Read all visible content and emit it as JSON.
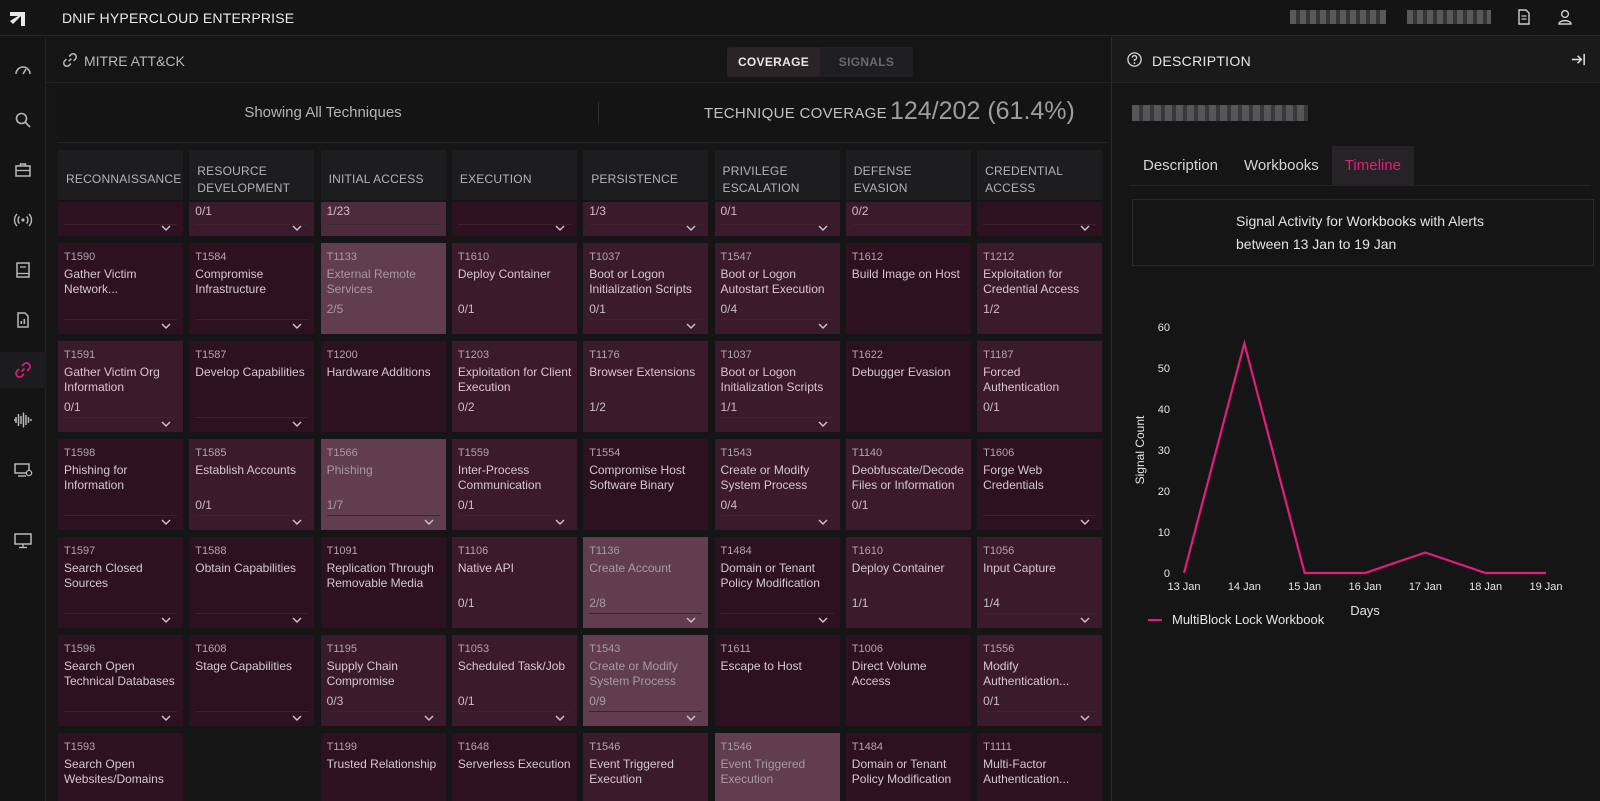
{
  "app": {
    "title": "DNIF HYPERCLOUD ENTERPRISE"
  },
  "topbar": {
    "icons": [
      "document-icon",
      "user-icon"
    ]
  },
  "nav": {
    "icons": [
      "dashboard-icon",
      "search-icon",
      "briefcase-icon",
      "signal-icon",
      "book-icon",
      "report-icon",
      "link-icon",
      "waveform-icon",
      "monitor-settings-icon",
      "desktop-icon"
    ],
    "active": "link-icon"
  },
  "mitre": {
    "title": "MITRE ATT&CK",
    "tabs": [
      {
        "label": "COVERAGE",
        "active": true
      },
      {
        "label": "SIGNALS",
        "active": false
      }
    ],
    "showing": "Showing All Techniques",
    "coverage_label": "TECHNIQUE COVERAGE",
    "coverage_value": "124/202 (61.4%)"
  },
  "matrix": {
    "columns": [
      {
        "header": "RECONNAISSANCE",
        "top_count": "",
        "top_shade": "base",
        "cards": [
          {
            "id": "T1590",
            "name": "Gather Victim Network...",
            "count": "",
            "shade": "base",
            "chevron": true
          },
          {
            "id": "T1591",
            "name": "Gather Victim Org Information",
            "count": "0/1",
            "shade": "light",
            "chevron": true
          },
          {
            "id": "T1598",
            "name": "Phishing for Information",
            "count": "",
            "shade": "base",
            "chevron": true
          },
          {
            "id": "T1597",
            "name": "Search Closed Sources",
            "count": "",
            "shade": "base",
            "chevron": true
          },
          {
            "id": "T1596",
            "name": "Search Open Technical Databases",
            "count": "",
            "shade": "base",
            "chevron": true
          },
          {
            "id": "T1593",
            "name": "Search Open Websites/Domains",
            "count": "",
            "shade": "base",
            "chevron": false
          }
        ]
      },
      {
        "header": "RESOURCE DEVELOPMENT",
        "top_count": "0/1",
        "top_shade": "light",
        "cards": [
          {
            "id": "T1584",
            "name": "Compromise Infrastructure",
            "count": "",
            "shade": "base",
            "chevron": true
          },
          {
            "id": "T1587",
            "name": "Develop Capabilities",
            "count": "",
            "shade": "base",
            "chevron": true
          },
          {
            "id": "T1585",
            "name": "Establish Accounts",
            "count": "0/1",
            "shade": "light",
            "chevron": true
          },
          {
            "id": "T1588",
            "name": "Obtain Capabilities",
            "count": "",
            "shade": "base",
            "chevron": true
          },
          {
            "id": "T1608",
            "name": "Stage Capabilities",
            "count": "",
            "shade": "base",
            "chevron": true
          }
        ]
      },
      {
        "header": "INITIAL ACCESS",
        "top_count": "1/23",
        "top_shade": "lighter",
        "cards": [
          {
            "id": "T1133",
            "name": "External Remote Services",
            "count": "2/5",
            "shade": "lightest",
            "chevron": false
          },
          {
            "id": "T1200",
            "name": "Hardware Additions",
            "count": "",
            "shade": "base",
            "chevron": false
          },
          {
            "id": "T1566",
            "name": "Phishing",
            "count": "1/7",
            "shade": "lightest",
            "chevron": true
          },
          {
            "id": "T1091",
            "name": "Replication Through Removable Media",
            "count": "",
            "shade": "base",
            "chevron": false
          },
          {
            "id": "T1195",
            "name": "Supply Chain Compromise",
            "count": "0/3",
            "shade": "light",
            "chevron": true
          },
          {
            "id": "T1199",
            "name": "Trusted Relationship",
            "count": "",
            "shade": "base",
            "chevron": false
          }
        ]
      },
      {
        "header": "EXECUTION",
        "top_count": "",
        "top_shade": "base",
        "cards": [
          {
            "id": "T1610",
            "name": "Deploy Container",
            "count": "0/1",
            "shade": "light",
            "chevron": false
          },
          {
            "id": "T1203",
            "name": "Exploitation for Client Execution",
            "count": "0/2",
            "shade": "light",
            "chevron": false
          },
          {
            "id": "T1559",
            "name": "Inter-Process Communication",
            "count": "0/1",
            "shade": "light",
            "chevron": true
          },
          {
            "id": "T1106",
            "name": "Native API",
            "count": "0/1",
            "shade": "light",
            "chevron": false
          },
          {
            "id": "T1053",
            "name": "Scheduled Task/Job",
            "count": "0/1",
            "shade": "light",
            "chevron": true
          },
          {
            "id": "T1648",
            "name": "Serverless Execution",
            "count": "",
            "shade": "base",
            "chevron": false
          }
        ]
      },
      {
        "header": "PERSISTENCE",
        "top_count": "1/3",
        "top_shade": "light",
        "cards": [
          {
            "id": "T1037",
            "name": "Boot or Logon Initialization Scripts",
            "count": "0/1",
            "shade": "light",
            "chevron": true
          },
          {
            "id": "T1176",
            "name": "Browser Extensions",
            "count": "1/2",
            "shade": "light",
            "chevron": false
          },
          {
            "id": "T1554",
            "name": "Compromise Host Software Binary",
            "count": "",
            "shade": "base",
            "chevron": false
          },
          {
            "id": "T1136",
            "name": "Create Account",
            "count": "2/8",
            "shade": "lightest",
            "chevron": true
          },
          {
            "id": "T1543",
            "name": "Create or Modify System Process",
            "count": "0/9",
            "shade": "lightest",
            "chevron": true
          },
          {
            "id": "T1546",
            "name": "Event Triggered Execution",
            "count": "",
            "shade": "light",
            "chevron": false
          }
        ]
      },
      {
        "header": "PRIVILEGE ESCALATION",
        "top_count": "0/1",
        "top_shade": "light",
        "cards": [
          {
            "id": "T1547",
            "name": "Boot or Logon Autostart Execution",
            "count": "0/4",
            "shade": "light",
            "chevron": true
          },
          {
            "id": "T1037",
            "name": "Boot or Logon Initialization Scripts",
            "count": "1/1",
            "shade": "light",
            "chevron": true
          },
          {
            "id": "T1543",
            "name": "Create or Modify System Process",
            "count": "0/4",
            "shade": "light",
            "chevron": true
          },
          {
            "id": "T1484",
            "name": "Domain or Tenant Policy Modification",
            "count": "",
            "shade": "base",
            "chevron": true
          },
          {
            "id": "T1611",
            "name": "Escape to Host",
            "count": "",
            "shade": "base",
            "chevron": false
          },
          {
            "id": "T1546",
            "name": "Event Triggered Execution",
            "count": "",
            "shade": "lightest",
            "chevron": false
          }
        ]
      },
      {
        "header": "DEFENSE EVASION",
        "top_count": "0/2",
        "top_shade": "light",
        "cards": [
          {
            "id": "T1612",
            "name": "Build Image on Host",
            "count": "",
            "shade": "base",
            "chevron": false
          },
          {
            "id": "T1622",
            "name": "Debugger Evasion",
            "count": "",
            "shade": "base",
            "chevron": false
          },
          {
            "id": "T1140",
            "name": "Deobfuscate/Decode Files or Information",
            "count": "0/1",
            "shade": "light",
            "chevron": false
          },
          {
            "id": "T1610",
            "name": "Deploy Container",
            "count": "1/1",
            "shade": "light",
            "chevron": false
          },
          {
            "id": "T1006",
            "name": "Direct Volume Access",
            "count": "",
            "shade": "base",
            "chevron": false
          },
          {
            "id": "T1484",
            "name": "Domain or Tenant Policy Modification",
            "count": "",
            "shade": "base",
            "chevron": false
          }
        ]
      },
      {
        "header": "CREDENTIAL ACCESS",
        "top_count": "",
        "top_shade": "base",
        "cards": [
          {
            "id": "T1212",
            "name": "Exploitation for Credential Access",
            "count": "1/2",
            "shade": "light",
            "chevron": false
          },
          {
            "id": "T1187",
            "name": "Forced Authentication",
            "count": "0/1",
            "shade": "light",
            "chevron": false
          },
          {
            "id": "T1606",
            "name": "Forge Web Credentials",
            "count": "",
            "shade": "base",
            "chevron": true
          },
          {
            "id": "T1056",
            "name": "Input Capture",
            "count": "1/4",
            "shade": "light",
            "chevron": true
          },
          {
            "id": "T1556",
            "name": "Modify Authentication...",
            "count": "0/1",
            "shade": "light",
            "chevron": true
          },
          {
            "id": "T1111",
            "name": "Multi-Factor Authentication...",
            "count": "",
            "shade": "base",
            "chevron": false
          }
        ]
      }
    ]
  },
  "panel": {
    "title": "DESCRIPTION",
    "tabs": [
      {
        "label": "Description",
        "active": false
      },
      {
        "label": "Workbooks",
        "active": false
      },
      {
        "label": "Timeline",
        "active": true
      }
    ],
    "chart_heading": "Signal Activity for Workbooks with Alerts between 13 Jan to 19 Jan"
  },
  "colors": {
    "accent": "#e31d7d",
    "card_base": "#2e1120",
    "card_light": "#3b1a2c",
    "card_lighter": "#4e2b3c",
    "card_lightest": "#623c4f"
  },
  "chart_data": {
    "type": "line",
    "x": [
      "13 Jan",
      "14 Jan",
      "15 Jan",
      "16 Jan",
      "17 Jan",
      "18 Jan",
      "19 Jan"
    ],
    "series": [
      {
        "name": "MultiBlock Lock Workbook",
        "values": [
          0,
          56,
          0,
          0,
          5,
          0,
          0
        ]
      }
    ],
    "xlabel": "Days",
    "ylabel": "Signal Count",
    "ylim": [
      0,
      60
    ],
    "yticks": [
      0,
      10,
      20,
      30,
      40,
      50,
      60
    ],
    "grid": false,
    "legend": "bottom-left"
  }
}
